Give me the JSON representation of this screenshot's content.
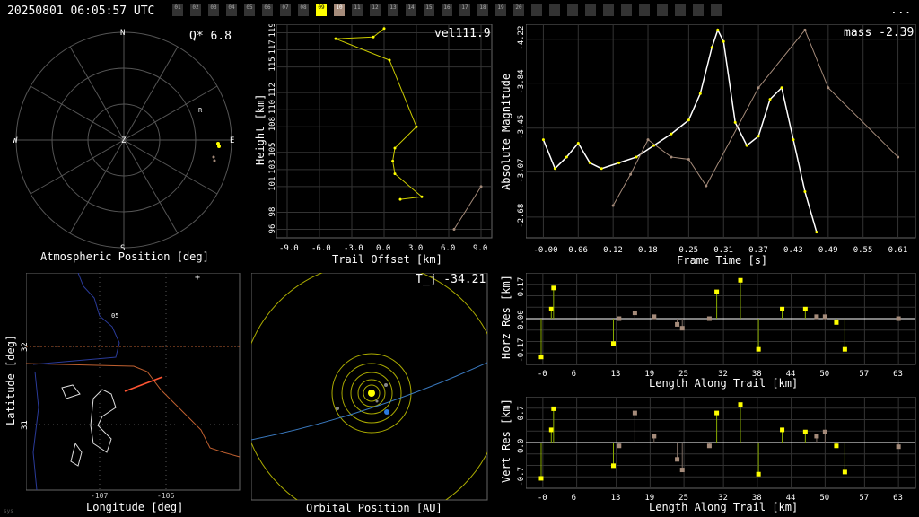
{
  "header": {
    "timestamp": "20250801 06:05:57 UTC",
    "menu": "...",
    "stations": [
      "01",
      "02",
      "03",
      "04",
      "05",
      "06",
      "07",
      "08",
      "09",
      "10",
      "11",
      "12",
      "13",
      "14",
      "15",
      "16",
      "17",
      "18",
      "19",
      "20",
      "",
      "",
      "",
      "",
      "",
      "",
      "",
      "",
      "",
      "",
      ""
    ],
    "stations_highlight": {
      "on": "09",
      "ref": "10"
    }
  },
  "panels": {
    "polar": {
      "title": "Atmospheric Position [deg]",
      "metric": "Q*  6.8",
      "compass": {
        "n": "N",
        "e": "E",
        "s": "S",
        "w": "W",
        "z": "Z"
      },
      "marker": "R"
    },
    "height": {
      "metric": "vel111.9",
      "xlabel": "Trail Offset [km]",
      "ylabel": "Height [km]",
      "xticks": [
        "-9.0",
        "-6.0",
        "-3.0",
        "0.0",
        "3.0",
        "6.0",
        "9.0"
      ],
      "yticks": [
        "96",
        "98",
        "101",
        "103",
        "105",
        "108",
        "110",
        "112",
        "115",
        "117",
        "119"
      ]
    },
    "magnitude": {
      "metric": "mass -2.39",
      "xlabel": "Frame Time [s]",
      "ylabel": "Absolute Magnitude",
      "xticks": [
        "-0.00",
        "0.06",
        "0.12",
        "0.18",
        "0.25",
        "0.31",
        "0.37",
        "0.43",
        "0.49",
        "0.55",
        "0.61"
      ],
      "yticks": [
        "-4.22",
        "-3.84",
        "-3.45",
        "-3.07",
        "-2.68"
      ]
    },
    "map": {
      "xlabel": "Longitude [deg]",
      "ylabel": "Latitude [deg]",
      "xticks": [
        "-107",
        "-106"
      ],
      "yticks": [
        "32",
        "31"
      ],
      "grid_label": "05"
    },
    "orbit": {
      "title": "Orbital Position [AU]",
      "metric": "T_j -34.21"
    },
    "horz": {
      "ylabel": "Horz Res [km]",
      "xlabel": "Length Along Trail [km]",
      "xticks": [
        "-0",
        "6",
        "13",
        "19",
        "25",
        "32",
        "38",
        "44",
        "50",
        "57",
        "63"
      ],
      "yticks": [
        "0.17",
        "0.00",
        "-0.17"
      ]
    },
    "vert": {
      "ylabel": "Vert Res [km]",
      "xlabel": "Length Along Trail [km]",
      "xticks": [
        "-0",
        "6",
        "13",
        "19",
        "25",
        "32",
        "38",
        "44",
        "50",
        "57",
        "63"
      ],
      "yticks": [
        "0.7",
        "0.0",
        "-0.7"
      ]
    }
  },
  "corner_note": "sys",
  "chart_data": [
    {
      "type": "line",
      "name": "height-vs-offset",
      "xlabel": "Trail Offset [km]",
      "ylabel": "Height [km]",
      "xlim": [
        -10,
        10
      ],
      "ylim": [
        95,
        120
      ],
      "series": [
        {
          "x": [
            0,
            -1,
            -4.5,
            0.5,
            3,
            1,
            0.8,
            1,
            3.5,
            1.5
          ],
          "y": [
            119.5,
            118.5,
            118.3,
            115.8,
            108,
            105.5,
            104,
            102.5,
            99.8,
            99.5
          ]
        },
        {
          "x": [
            6.5,
            9
          ],
          "y": [
            96,
            101
          ]
        }
      ]
    },
    {
      "type": "line",
      "name": "magnitude-vs-time",
      "xlabel": "Frame Time [s]",
      "ylabel": "Absolute Magnitude",
      "xlim": [
        -0.03,
        0.64
      ],
      "ylim": [
        -2.5,
        -4.35
      ],
      "series": [
        {
          "x": [
            0,
            0.02,
            0.04,
            0.06,
            0.08,
            0.1,
            0.13,
            0.16,
            0.19,
            0.22,
            0.25,
            0.27,
            0.29,
            0.3,
            0.31,
            0.33,
            0.35,
            0.37,
            0.39,
            0.41,
            0.43,
            0.45,
            0.47
          ],
          "y": [
            -3.35,
            -3.1,
            -3.2,
            -3.32,
            -3.15,
            -3.1,
            -3.15,
            -3.2,
            -3.3,
            -3.4,
            -3.52,
            -3.75,
            -4.15,
            -4.3,
            -4.2,
            -3.5,
            -3.3,
            -3.38,
            -3.7,
            -3.8,
            -3.35,
            -2.9,
            -2.55
          ]
        },
        {
          "x": [
            0.12,
            0.15,
            0.18,
            0.22,
            0.25,
            0.28,
            0.37,
            0.45,
            0.49,
            0.61
          ],
          "y": [
            -2.78,
            -3.05,
            -3.35,
            -3.2,
            -3.18,
            -2.95,
            -3.8,
            -4.3,
            -3.8,
            -3.2
          ]
        }
      ]
    },
    {
      "type": "bar",
      "name": "horz-residuals",
      "xlabel": "Length Along Trail [km]",
      "ylabel": "Horz Res [km]",
      "xlim": [
        -3,
        66
      ],
      "ylim": [
        -0.22,
        0.22
      ],
      "station_a": {
        "x": [
          -0.3,
          1.5,
          1.9,
          12.5,
          30.8,
          35,
          38.2,
          42.4,
          46.5,
          52,
          53.5
        ],
        "y": [
          -0.2,
          0.05,
          0.16,
          -0.13,
          0.14,
          0.2,
          -0.16,
          0.05,
          0.05,
          -0.02,
          -0.16
        ]
      },
      "station_b": {
        "x": [
          13.5,
          16.3,
          19.7,
          23.8,
          24.7,
          29.5,
          48.5,
          50,
          63
        ],
        "y": [
          0,
          0.03,
          0.01,
          -0.03,
          -0.05,
          0,
          0.01,
          0.01,
          0
        ]
      }
    },
    {
      "type": "bar",
      "name": "vert-residuals",
      "xlabel": "Length Along Trail [km]",
      "ylabel": "Vert Res [km]",
      "xlim": [
        -3,
        66
      ],
      "ylim": [
        -1,
        1
      ],
      "station_a": {
        "x": [
          -0.3,
          1.5,
          1.9,
          12.5,
          30.8,
          35,
          38.2,
          42.4,
          46.5,
          52,
          53.5
        ],
        "y": [
          -0.85,
          0.3,
          0.8,
          -0.55,
          0.7,
          0.9,
          -0.75,
          0.3,
          0.25,
          -0.08,
          -0.7
        ]
      },
      "station_b": {
        "x": [
          13.5,
          16.3,
          19.7,
          23.8,
          24.7,
          29.5,
          48.5,
          50,
          63
        ],
        "y": [
          -0.08,
          0.7,
          0.15,
          -0.4,
          -0.65,
          -0.08,
          0.15,
          0.25,
          -0.1
        ]
      }
    }
  ]
}
